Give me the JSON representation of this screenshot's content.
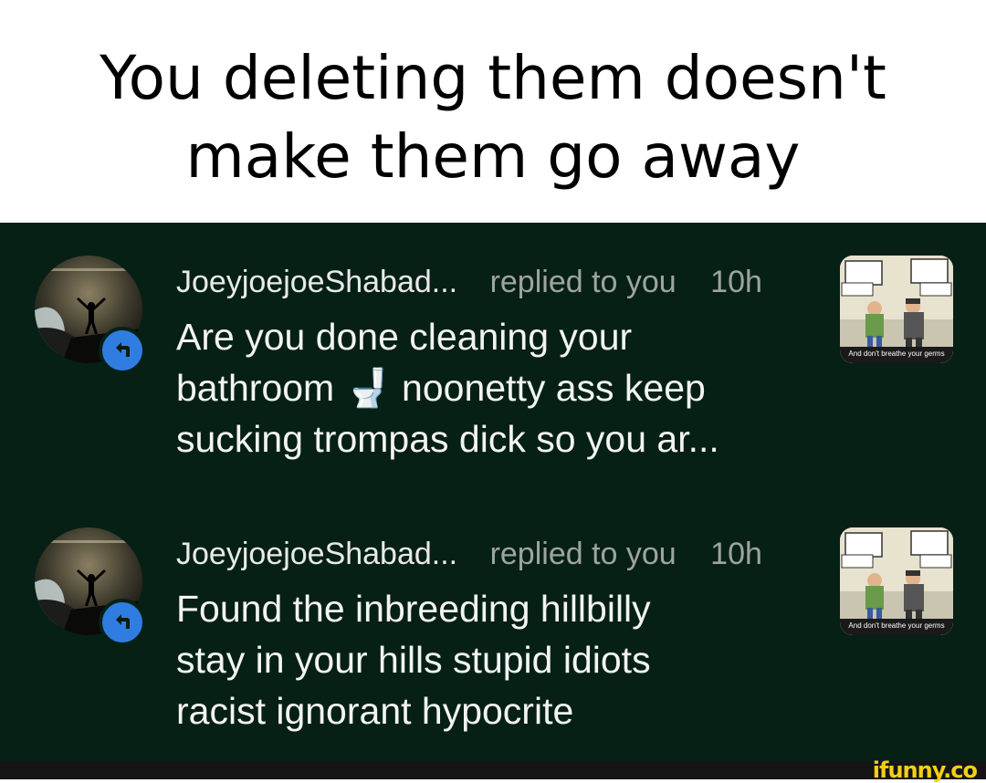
{
  "caption": {
    "line1": "You deleting them doesn't",
    "line2": "make them go away"
  },
  "notifications": [
    {
      "username": "JoeyjoejoeShabad...",
      "action": "replied to you",
      "time": "10h",
      "lines": [
        "Are you done cleaning your",
        "bathroom 🚽 noonetty ass keep",
        "sucking trompas dick so you ar..."
      ],
      "thumb_caption": "And don't breathe your germs"
    },
    {
      "username": "JoeyjoejoeShabad...",
      "action": "replied to you",
      "time": "10h",
      "lines": [
        "Found the inbreeding hillbilly",
        "stay in your hills stupid idiots",
        "racist ignorant hypocrite"
      ],
      "thumb_caption": "And don't breathe your germs"
    }
  ],
  "watermark": "ifunny.co",
  "colors": {
    "panel_bg": "#072016",
    "reply_badge": "#2f7de1",
    "watermark": "#f2cf17"
  }
}
